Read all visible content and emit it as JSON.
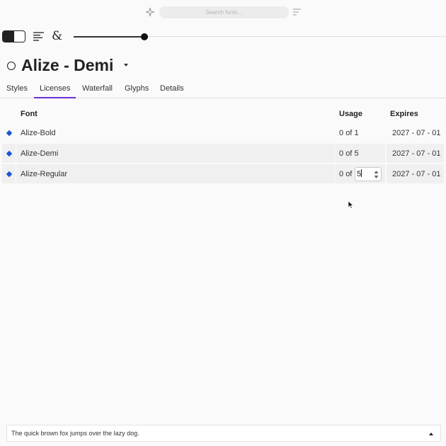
{
  "search": {
    "placeholder": "Search fonts..."
  },
  "title": {
    "text": "Alize - Demi"
  },
  "tabs": [
    {
      "label": "Styles"
    },
    {
      "label": "Licenses",
      "active": true
    },
    {
      "label": "Waterfall"
    },
    {
      "label": "Glyphs"
    },
    {
      "label": "Details"
    }
  ],
  "table": {
    "headers": {
      "font": "Font",
      "usage": "Usage",
      "expires": "Expires"
    },
    "rows": [
      {
        "font": "Alize-Bold",
        "usage_used": "0",
        "usage_of": "of",
        "usage_total": "1",
        "expires": "2027 - 07 - 01"
      },
      {
        "font": "Alize-Demi",
        "usage_used": "0",
        "usage_of": "of",
        "usage_total": "5",
        "expires": "2027 - 07 - 01"
      },
      {
        "font": "Alize-Regular",
        "usage_used": "0",
        "usage_of": "of",
        "usage_total": "5",
        "expires": "2027 - 07 - 01"
      }
    ]
  },
  "preview": {
    "text": "The quick brown fox jumps over the lazy dog."
  },
  "colors": {
    "accent": "#6a2fd6",
    "diamond": "#1a55d6"
  },
  "icons": {
    "sparkle": "sparkle-icon",
    "filter": "filter-icon",
    "align": "align-left-icon",
    "ampersand": "&"
  }
}
